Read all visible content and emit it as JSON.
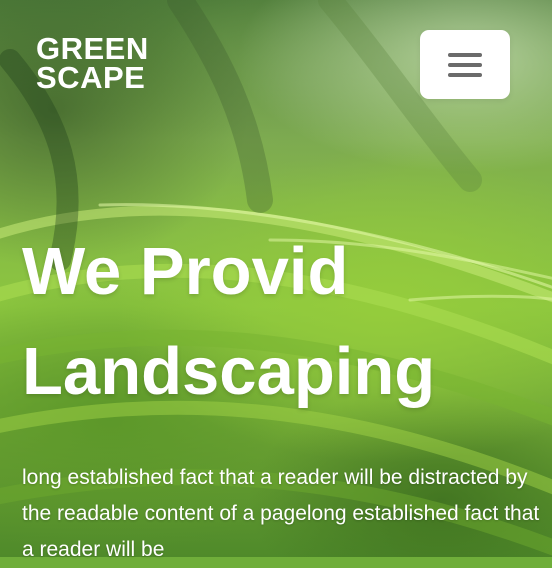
{
  "brand": {
    "line1": "GREEN",
    "line2": "SCAPE"
  },
  "nav": {
    "menu_icon": "hamburger-menu-icon"
  },
  "hero": {
    "heading_line1": "We Provid",
    "heading_line2": "Landscaping",
    "paragraph": "long established fact that a reader will be distracted by the readable content of a pagelong established fact that a reader will be"
  },
  "colors": {
    "menu_button_bg": "#ffffff",
    "menu_icon": "#6b6b6b",
    "text": "#ffffff",
    "leaf_green": "#8cc63f"
  }
}
